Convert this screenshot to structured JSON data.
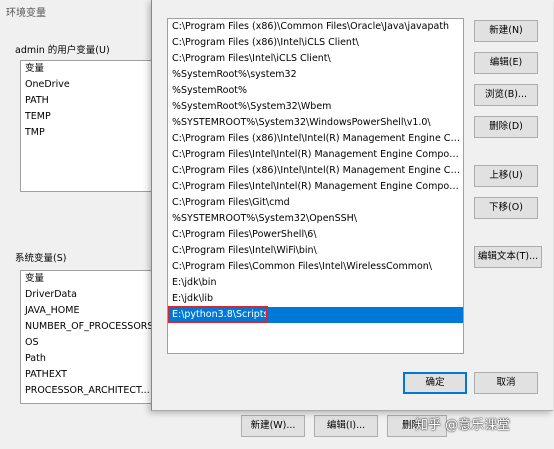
{
  "background_dialog": {
    "title": "环境变量",
    "user_vars_label": "admin 的用户变量(U)",
    "user_vars_header": "变量",
    "user_vars": [
      "OneDrive",
      "PATH",
      "TEMP",
      "TMP"
    ],
    "system_vars_label": "系统变量(S)",
    "system_vars_header": "变量",
    "system_vars": [
      "DriverData",
      "JAVA_HOME",
      "NUMBER_OF_PROCESSORS",
      "OS",
      "Path",
      "PATHEXT",
      "PROCESSOR_ARCHITECT..."
    ],
    "buttons": {
      "new": "新建(W)...",
      "edit": "编辑(I)...",
      "delete": "删除"
    }
  },
  "edit_dialog": {
    "paths": [
      "C:\\Program Files (x86)\\Common Files\\Oracle\\Java\\javapath",
      "C:\\Program Files (x86)\\Intel\\iCLS Client\\",
      "C:\\Program Files\\Intel\\iCLS Client\\",
      "%SystemRoot%\\system32",
      "%SystemRoot%",
      "%SystemRoot%\\System32\\Wbem",
      "%SYSTEMROOT%\\System32\\WindowsPowerShell\\v1.0\\",
      "C:\\Program Files (x86)\\Intel\\Intel(R) Management Engine Comp...",
      "C:\\Program Files\\Intel\\Intel(R) Management Engine Component...",
      "C:\\Program Files (x86)\\Intel\\Intel(R) Management Engine Comp...",
      "C:\\Program Files\\Intel\\Intel(R) Management Engine Component...",
      "C:\\Program Files\\Git\\cmd",
      "%SYSTEMROOT%\\System32\\OpenSSH\\",
      "C:\\Program Files\\PowerShell\\6\\",
      "C:\\Program Files\\Intel\\WiFi\\bin\\",
      "C:\\Program Files\\Common Files\\Intel\\WirelessCommon\\",
      "E:\\jdk\\bin",
      "E:\\jdk\\lib",
      "E:\\python3.8\\Scripts"
    ],
    "selected_index": 18,
    "buttons": {
      "new": "新建(N)",
      "edit": "编辑(E)",
      "browse": "浏览(B)...",
      "delete": "删除(D)",
      "move_up": "上移(U)",
      "move_down": "下移(O)",
      "edit_text": "编辑文本(T)...",
      "ok": "确定",
      "cancel": "取消"
    }
  },
  "watermark": "知乎 @意乐课堂"
}
